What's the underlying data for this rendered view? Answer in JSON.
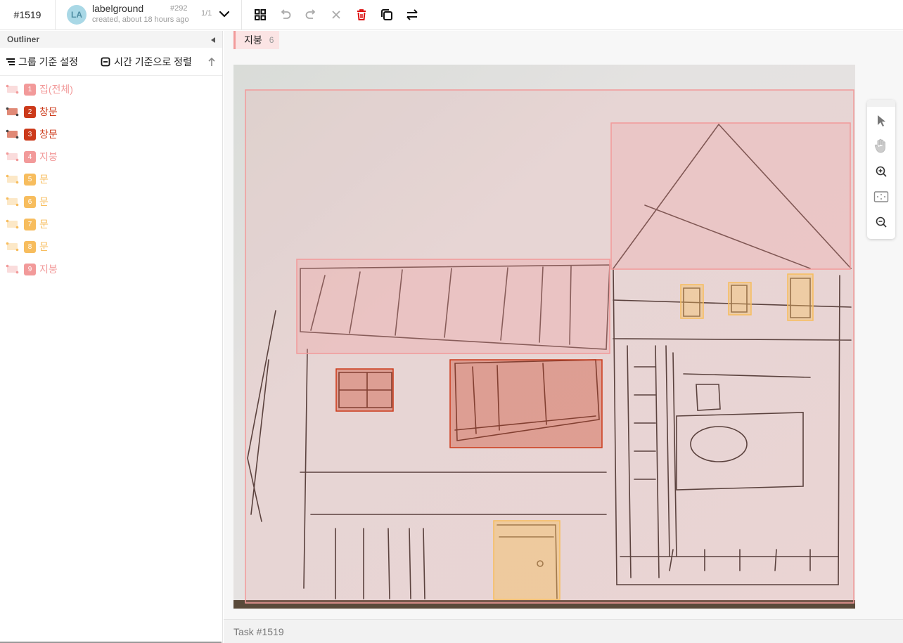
{
  "header": {
    "task_id": "#1519",
    "avatar_initials": "LA",
    "project_name": "labelground",
    "project_number": "#292",
    "created": "created, about 18 hours ago",
    "pager": "1/1"
  },
  "toolbar_icons": [
    "grid-icon",
    "undo-icon",
    "redo-icon",
    "close-icon",
    "trash-icon",
    "copy-icon",
    "swap-icon"
  ],
  "sidebar": {
    "title": "Outliner",
    "group_label": "그룹 기준 설정",
    "sort_label": "시간 기준으로 정렬",
    "objects": [
      {
        "num": "1",
        "label": "집(전체)",
        "color": "#f29a9a",
        "selected": false
      },
      {
        "num": "2",
        "label": "창문",
        "color": "#cc3a1a",
        "selected": true
      },
      {
        "num": "3",
        "label": "창문",
        "color": "#cc3a1a",
        "selected": true
      },
      {
        "num": "4",
        "label": "지붕",
        "color": "#f29a9a",
        "selected": false
      },
      {
        "num": "5",
        "label": "문",
        "color": "#f7bd5e",
        "selected": false
      },
      {
        "num": "6",
        "label": "문",
        "color": "#f7bd5e",
        "selected": false
      },
      {
        "num": "7",
        "label": "문",
        "color": "#f7bd5e",
        "selected": false
      },
      {
        "num": "8",
        "label": "문",
        "color": "#f7bd5e",
        "selected": false
      },
      {
        "num": "9",
        "label": "지붕",
        "color": "#f29a9a",
        "selected": false
      }
    ]
  },
  "main": {
    "chip_label": "지붕",
    "chip_count": "6"
  },
  "footer": {
    "task_text": "Task #1519"
  },
  "colors": {
    "house": "#f29a9a",
    "window": "#cc3a1a",
    "door": "#f7bd5e"
  }
}
